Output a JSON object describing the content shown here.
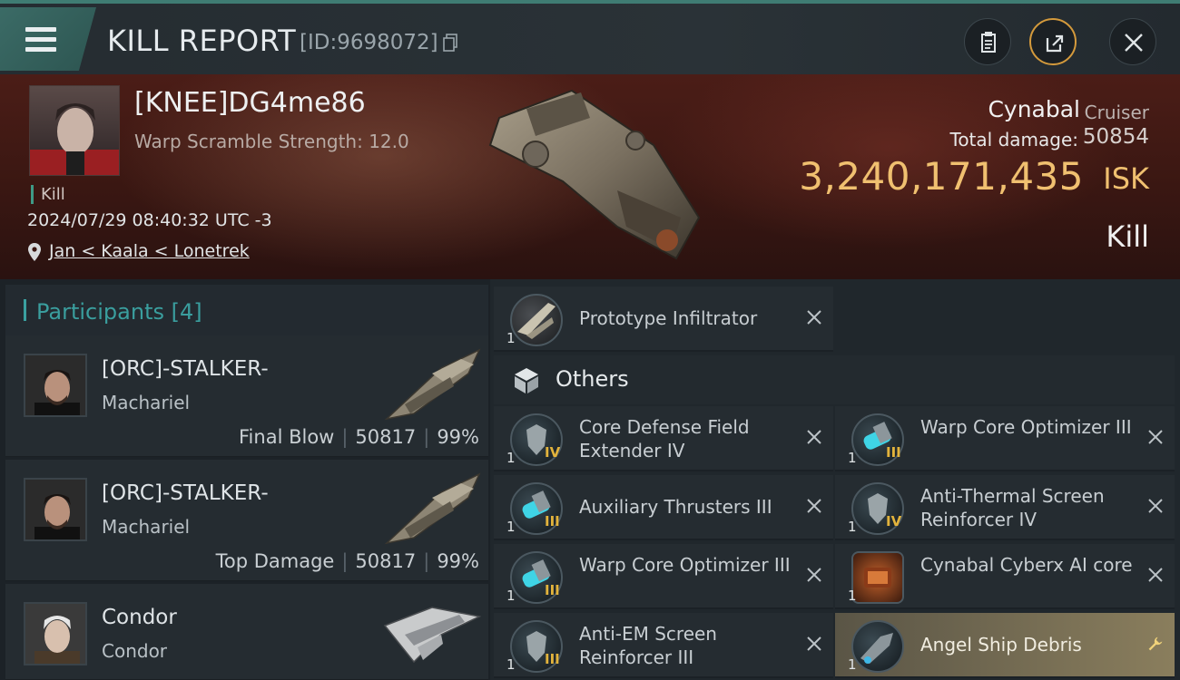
{
  "header": {
    "title": "KILL REPORT",
    "report_id": "[ID:9698072]",
    "icons": [
      "menu-icon",
      "clipboard-icon",
      "share-icon",
      "close-icon"
    ]
  },
  "victim": {
    "name": "[KNEE]DG4me86",
    "stat": "Warp Scramble Strength: 12.0",
    "tag": "Kill",
    "timestamp": "2024/07/29 08:40:32 UTC -3",
    "location": "Jan < Kaala < Lonetrek",
    "ship_name": "Cynabal",
    "ship_class": "Cruiser",
    "damage_label": "Total damage:",
    "damage_value": "50854",
    "isk_value": "3,240,171,435",
    "isk_unit": "ISK",
    "result": "Kill"
  },
  "participants": {
    "label": "Participants [4]",
    "rows": [
      {
        "name": "[ORC]-STALKER-",
        "ship": "Machariel",
        "role": "Final Blow",
        "damage": "50817",
        "percent": "99%"
      },
      {
        "name": "[ORC]-STALKER-",
        "ship": "Machariel",
        "role": "Top Damage",
        "damage": "50817",
        "percent": "99%"
      },
      {
        "name": "Condor",
        "ship": "Condor",
        "role": "",
        "damage": "",
        "percent": ""
      }
    ]
  },
  "modules": {
    "top_item": {
      "name": "Prototype  Infiltrator",
      "qty": "1"
    },
    "others_label": "Others",
    "items": [
      {
        "name": "Core Defense Field Extender IV",
        "qty": "1",
        "tier": "IV"
      },
      {
        "name": "Warp Core Optimizer III",
        "qty": "1",
        "tier": "III"
      },
      {
        "name": "Auxiliary Thrusters III",
        "qty": "1",
        "tier": "III"
      },
      {
        "name": "Anti-Thermal Screen Reinforcer IV",
        "qty": "1",
        "tier": "IV"
      },
      {
        "name": "Warp Core Optimizer III",
        "qty": "1",
        "tier": "III"
      },
      {
        "name": "Cynabal Cyberx AI core",
        "qty": "1",
        "tier": ""
      },
      {
        "name": "Anti-EM Screen Reinforcer III",
        "qty": "1",
        "tier": "III"
      },
      {
        "name": "Angel Ship Debris",
        "qty": "1",
        "tier": ""
      }
    ]
  },
  "colors": {
    "accent_teal": "#3a9e9e",
    "isk_gold": "#f0c070",
    "tier_gold": "#e2b33c"
  }
}
